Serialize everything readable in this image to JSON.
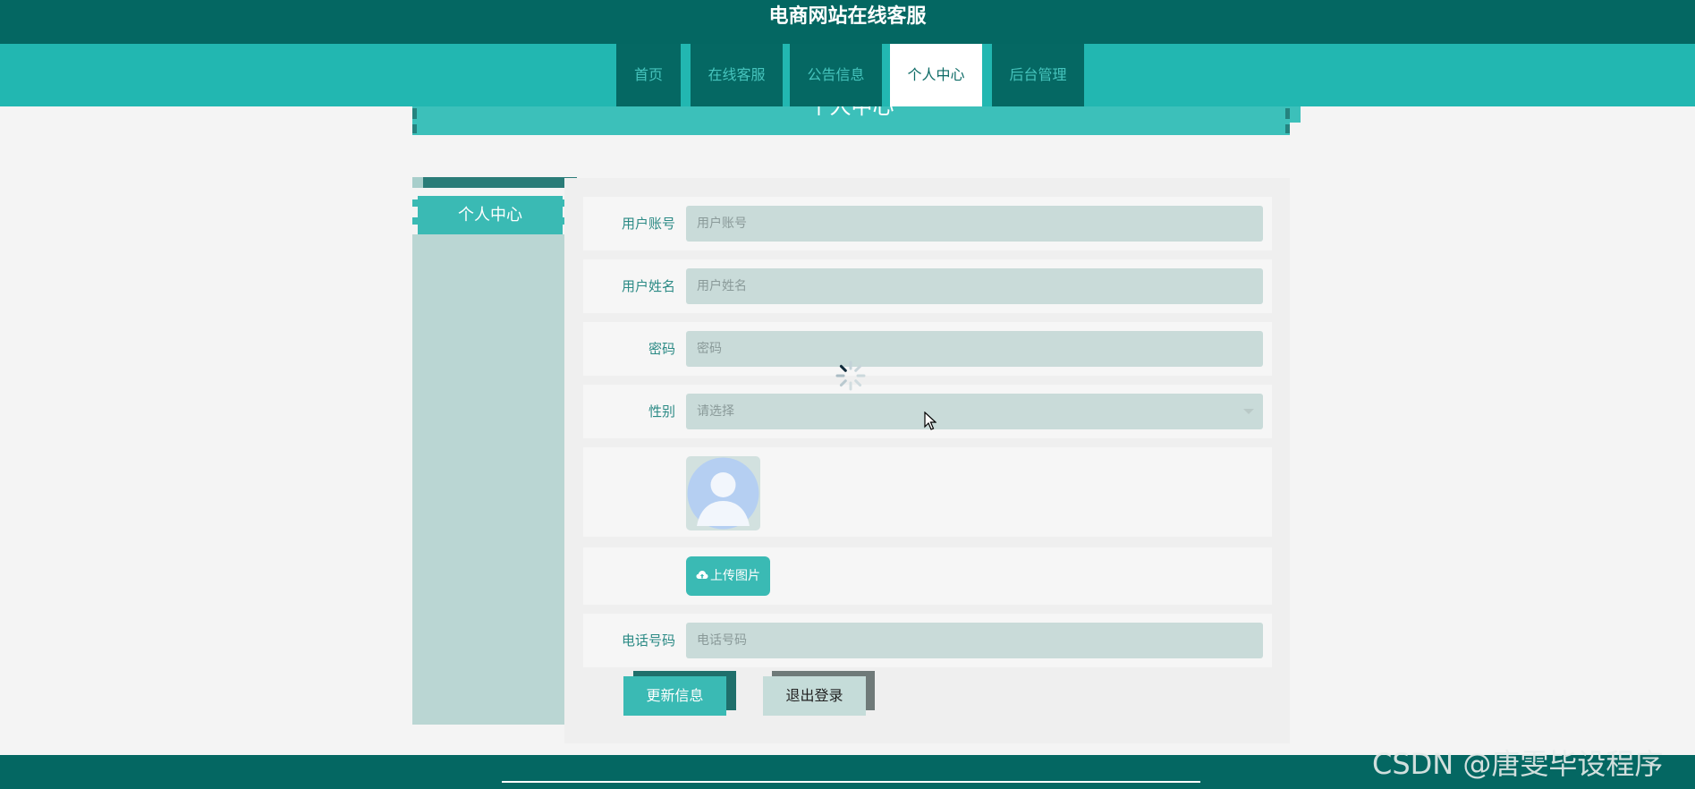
{
  "site": {
    "title": "电商网站在线客服"
  },
  "nav": {
    "items": [
      {
        "label": "首页"
      },
      {
        "label": "在线客服"
      },
      {
        "label": "公告信息"
      },
      {
        "label": "个人中心"
      },
      {
        "label": "后台管理"
      }
    ],
    "active": "个人中心"
  },
  "page": {
    "header_title": "个人中心"
  },
  "sidebar": {
    "items": [
      {
        "label": "个人中心"
      }
    ]
  },
  "form": {
    "username": {
      "label": "用户账号",
      "placeholder": "用户账号"
    },
    "name": {
      "label": "用户姓名",
      "placeholder": "用户姓名"
    },
    "password": {
      "label": "密码",
      "placeholder": "密码"
    },
    "gender": {
      "label": "性别",
      "placeholder": "请选择"
    },
    "upload_label": "上传图片",
    "phone": {
      "label": "电话号码",
      "placeholder": "电话号码"
    },
    "update_button": "更新信息",
    "logout_button": "退出登录"
  },
  "colors": {
    "header_bg": "#046762",
    "nav_bg": "#22b7b1",
    "accent": "#3abab4"
  },
  "watermark": "CSDN @唐雯毕设程序"
}
